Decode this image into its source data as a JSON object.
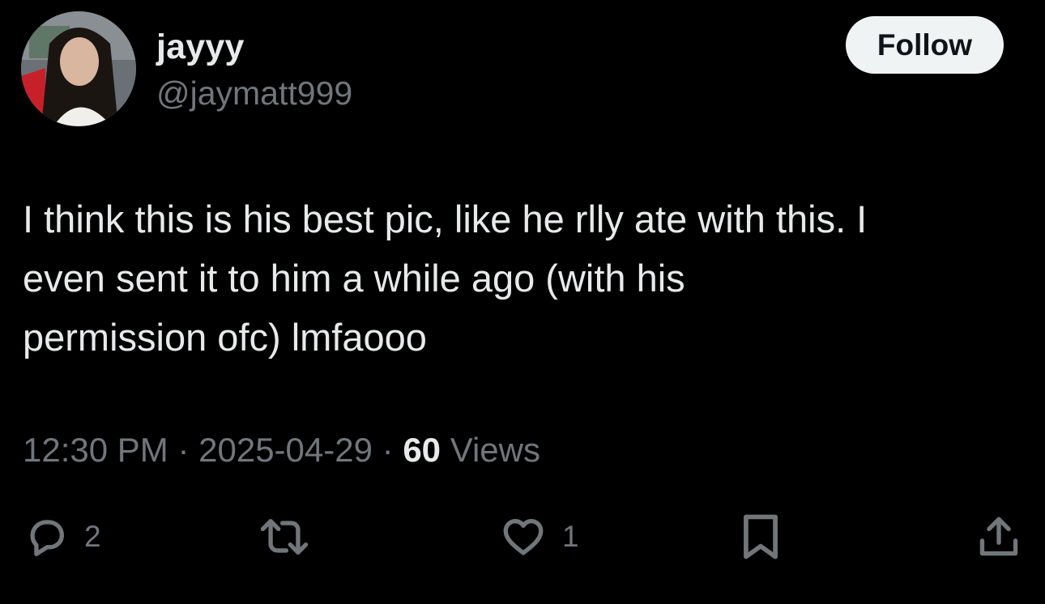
{
  "author": {
    "display_name": "jayyy",
    "handle": "@jaymatt999",
    "avatar_icon": "profile-photo"
  },
  "follow_button": {
    "label": "Follow"
  },
  "tweet": {
    "lines": [
      "I think this is his best pic, like he rlly ate with this. I",
      "even sent it to him a while ago (with his",
      "permission ofc) lmfaooo"
    ]
  },
  "meta": {
    "time": "12:30 PM",
    "separator": "·",
    "date": "2025-04-29",
    "views_count": "60",
    "views_label": "Views"
  },
  "actions": {
    "reply": {
      "icon": "reply-icon",
      "count": "2"
    },
    "repost": {
      "icon": "repost-icon"
    },
    "like": {
      "icon": "heart-icon",
      "count": "1"
    },
    "bookmark": {
      "icon": "bookmark-icon"
    },
    "share": {
      "icon": "share-icon"
    }
  },
  "colors": {
    "background": "#000000",
    "primary_text": "#e7e9ea",
    "secondary_text": "#71767b",
    "follow_bg": "#eff3f4",
    "follow_text": "#0f1419"
  }
}
